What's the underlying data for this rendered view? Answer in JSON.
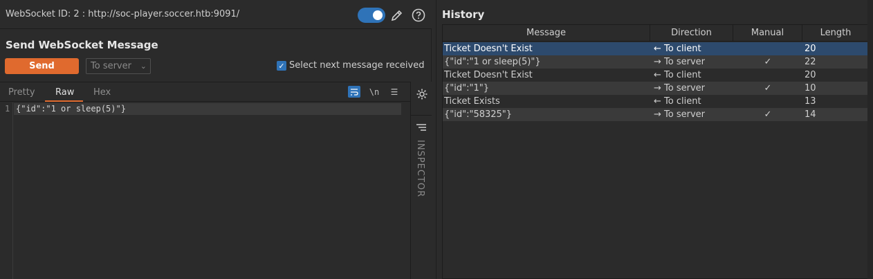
{
  "request_panel": {
    "websocket_label": "WebSocket ID: 2 : http://soc-player.soccer.htb:9091/",
    "title": "Send WebSocket Message",
    "send_label": "Send",
    "direction_value": "To server",
    "select_next_label": "Select next message received",
    "select_next_checked": true,
    "tabs": [
      "Pretty",
      "Raw",
      "Hex"
    ],
    "active_tab": "Raw",
    "editor": {
      "line_number": "1",
      "content": "{\"id\":\"1 or sleep(5)\"}"
    },
    "editor_icons": {
      "wrap": "wrap-lines-icon",
      "newline": "\\n",
      "menu": "menu-icon"
    },
    "inspector_label": "INSPECTOR"
  },
  "history": {
    "title": "History",
    "columns": [
      "Message",
      "Direction",
      "Manual",
      "Length"
    ],
    "rows": [
      {
        "message": "Ticket Doesn't Exist",
        "direction": "← To client",
        "manual": "",
        "length": "20"
      },
      {
        "message": "{\"id\":\"1 or sleep(5)\"}",
        "direction": "→ To server",
        "manual": "✓",
        "length": "22"
      },
      {
        "message": "Ticket Doesn't Exist",
        "direction": "← To client",
        "manual": "",
        "length": "20"
      },
      {
        "message": "{\"id\":\"1\"}",
        "direction": "→ To server",
        "manual": "✓",
        "length": "10"
      },
      {
        "message": "Ticket Exists",
        "direction": "← To client",
        "manual": "",
        "length": "13"
      },
      {
        "message": "{\"id\":\"58325\"}",
        "direction": "→ To server",
        "manual": "✓",
        "length": "14"
      }
    ],
    "selected_row": 0
  },
  "colors": {
    "accent_orange": "#e06a2e",
    "accent_blue": "#2f73b8",
    "selection": "#2d4a6d",
    "background": "#2b2b2b"
  }
}
